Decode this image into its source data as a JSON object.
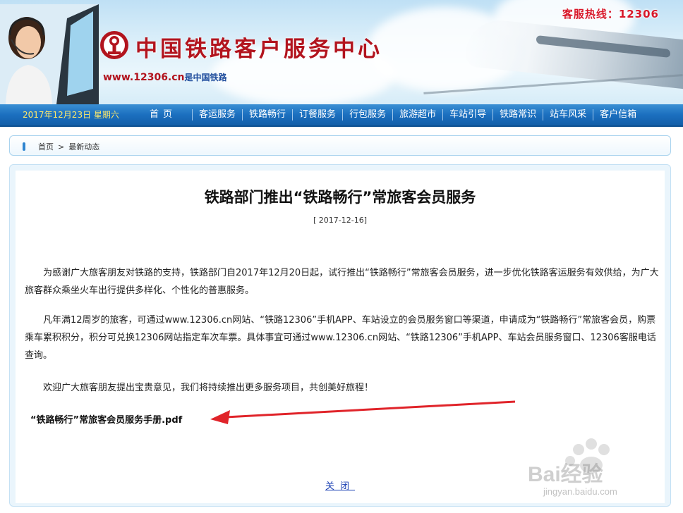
{
  "header": {
    "hotline": "客服热线：12306",
    "site_title": "中国铁路客户服务中心",
    "site_url": "www.12306.cn",
    "site_url_suffix": "是中国铁路"
  },
  "nav": {
    "date": "2017年12月23日 星期六",
    "items": [
      "首页",
      "客运服务",
      "铁路畅行",
      "订餐服务",
      "行包服务",
      "旅游超市",
      "车站引导",
      "铁路常识",
      "站车风采",
      "客户信箱"
    ]
  },
  "breadcrumb": {
    "home": "首页",
    "sep": ">",
    "current": "最新动态"
  },
  "article": {
    "title": "铁路部门推出“铁路畅行”常旅客会员服务",
    "date": "[ 2017-12-16]",
    "paragraphs": [
      "为感谢广大旅客朋友对铁路的支持，铁路部门自2017年12月20日起，试行推出“铁路畅行”常旅客会员服务，进一步优化铁路客运服务有效供给，为广大旅客群众乘坐火车出行提供多样化、个性化的普惠服务。",
      "凡年满12周岁的旅客，可通过www.12306.cn网站、“铁路12306”手机APP、车站设立的会员服务窗口等渠道，申请成为“铁路畅行”常旅客会员，购票乘车累积积分，积分可兑换12306网站指定车次车票。具体事宜可通过www.12306.cn网站、“铁路12306”手机APP、车站会员服务窗口、12306客服电话查询。",
      "欢迎广大旅客朋友提出宝贵意见，我们将持续推出更多服务项目，共创美好旅程！"
    ],
    "attachment": "“铁路畅行”常旅客会员服务手册.pdf",
    "close_label": "关闭"
  },
  "watermark": {
    "brand": "Bai经验",
    "url": "jingyan.baidu.com"
  },
  "colors": {
    "brand_red": "#b2141e",
    "nav_blue": "#1b6fbf",
    "date_yellow": "#ffe96a",
    "link_blue": "#1a3fb3",
    "annotation_red": "#e0242a"
  }
}
